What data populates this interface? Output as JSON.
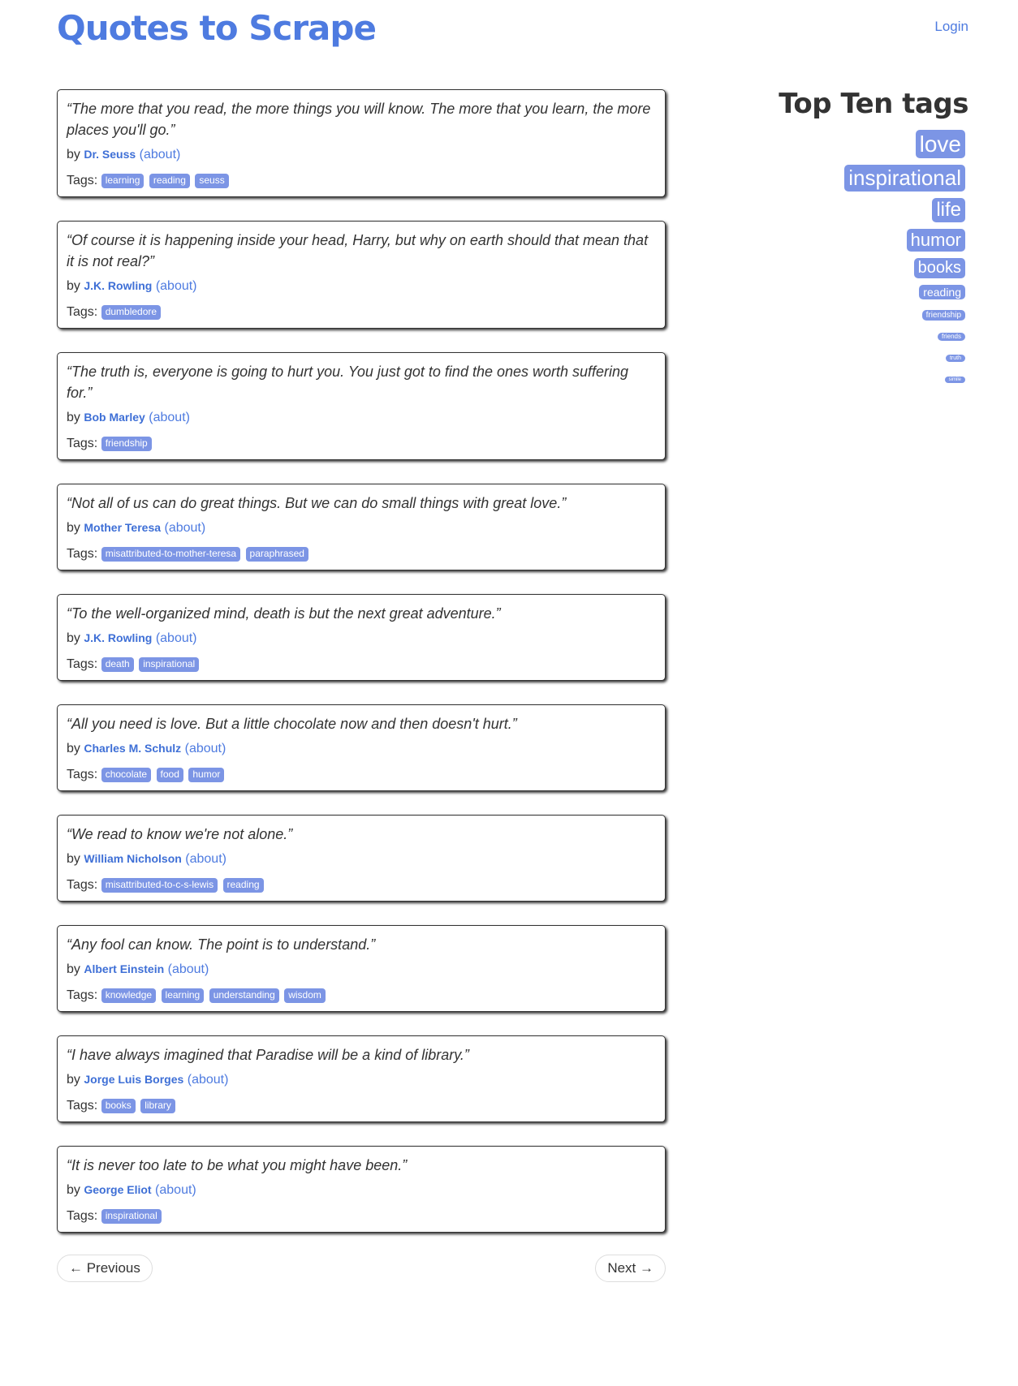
{
  "header": {
    "title": "Quotes to Scrape",
    "login_label": "Login"
  },
  "labels": {
    "by": "by",
    "about": "(about)",
    "tags": "Tags:"
  },
  "quotes": [
    {
      "text": "“The more that you read, the more things you will know. The more that you learn, the more places you'll go.”",
      "author": "Dr. Seuss",
      "tags": [
        "learning",
        "reading",
        "seuss"
      ]
    },
    {
      "text": "“Of course it is happening inside your head, Harry, but why on earth should that mean that it is not real?”",
      "author": "J.K. Rowling",
      "tags": [
        "dumbledore"
      ]
    },
    {
      "text": "“The truth is, everyone is going to hurt you. You just got to find the ones worth suffering for.”",
      "author": "Bob Marley",
      "tags": [
        "friendship"
      ]
    },
    {
      "text": "“Not all of us can do great things. But we can do small things with great love.”",
      "author": "Mother Teresa",
      "tags": [
        "misattributed-to-mother-teresa",
        "paraphrased"
      ]
    },
    {
      "text": "“To the well-organized mind, death is but the next great adventure.”",
      "author": "J.K. Rowling",
      "tags": [
        "death",
        "inspirational"
      ]
    },
    {
      "text": "“All you need is love. But a little chocolate now and then doesn't hurt.”",
      "author": "Charles M. Schulz",
      "tags": [
        "chocolate",
        "food",
        "humor"
      ]
    },
    {
      "text": "“We read to know we're not alone.”",
      "author": "William Nicholson",
      "tags": [
        "misattributed-to-c-s-lewis",
        "reading"
      ]
    },
    {
      "text": "“Any fool can know. The point is to understand.”",
      "author": "Albert Einstein",
      "tags": [
        "knowledge",
        "learning",
        "understanding",
        "wisdom"
      ]
    },
    {
      "text": "“I have always imagined that Paradise will be a kind of library.”",
      "author": "Jorge Luis Borges",
      "tags": [
        "books",
        "library"
      ]
    },
    {
      "text": "“It is never too late to be what you might have been.”",
      "author": "George Eliot",
      "tags": [
        "inspirational"
      ]
    }
  ],
  "pager": {
    "previous_label": "← Previous",
    "next_label": "Next →"
  },
  "sidebar": {
    "heading": "Top Ten tags",
    "tags": [
      "love",
      "inspirational",
      "life",
      "humor",
      "books",
      "reading",
      "friendship",
      "friends",
      "truth",
      "simile"
    ]
  },
  "colors": {
    "accent": "#4e7be0",
    "tag_background": "#7c95e5"
  }
}
